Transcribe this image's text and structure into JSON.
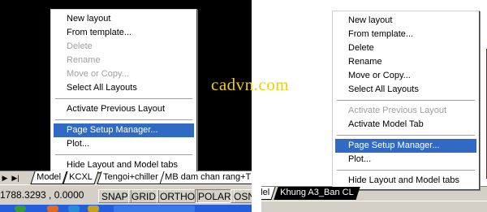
{
  "left_screenshot": {
    "context_menu": {
      "items": [
        {
          "label": "New layout",
          "enabled": true
        },
        {
          "label": "From template...",
          "enabled": true
        },
        {
          "label": "Delete",
          "enabled": false
        },
        {
          "label": "Rename",
          "enabled": false
        },
        {
          "label": "Move or Copy...",
          "enabled": false
        },
        {
          "label": "Select All Layouts",
          "enabled": true
        },
        {
          "label": "Activate Previous Layout",
          "enabled": true
        },
        {
          "label": "Page Setup Manager...",
          "enabled": true,
          "highlighted": true
        },
        {
          "label": "Plot...",
          "enabled": true
        },
        {
          "label": "Hide Layout and Model tabs",
          "enabled": true
        }
      ]
    },
    "tabs": [
      "Model",
      "KCXL",
      "Tengoi+chiller",
      "MB dam chan rang+TK"
    ],
    "status": {
      "coordinates": "1788.3293 , 0.0000",
      "buttons": [
        "SNAP",
        "GRID",
        "ORTHO",
        "POLAR",
        "OSN"
      ]
    }
  },
  "right_screenshot": {
    "context_menu": {
      "items": [
        {
          "label": "New layout",
          "enabled": true
        },
        {
          "label": "From template...",
          "enabled": true
        },
        {
          "label": "Delete",
          "enabled": true
        },
        {
          "label": "Rename",
          "enabled": true
        },
        {
          "label": "Move or Copy...",
          "enabled": true
        },
        {
          "label": "Select All Layouts",
          "enabled": true
        },
        {
          "label": "Activate Previous Layout",
          "enabled": false
        },
        {
          "label": "Activate Model Tab",
          "enabled": true
        },
        {
          "label": "Page Setup Manager...",
          "enabled": true,
          "highlighted": true
        },
        {
          "label": "Plot...",
          "enabled": true
        },
        {
          "label": "Hide Layout and Model tabs",
          "enabled": true
        }
      ]
    },
    "tabs": [
      "lel",
      "Khung A3_Ban CL"
    ]
  },
  "watermark": "cadvn.com",
  "colors": {
    "highlight": "#316ac5",
    "drawing_background": "#000000",
    "chrome": "#d4d0c8",
    "disabled_text": "#a0a0a0",
    "watermark": "#f0d000"
  }
}
